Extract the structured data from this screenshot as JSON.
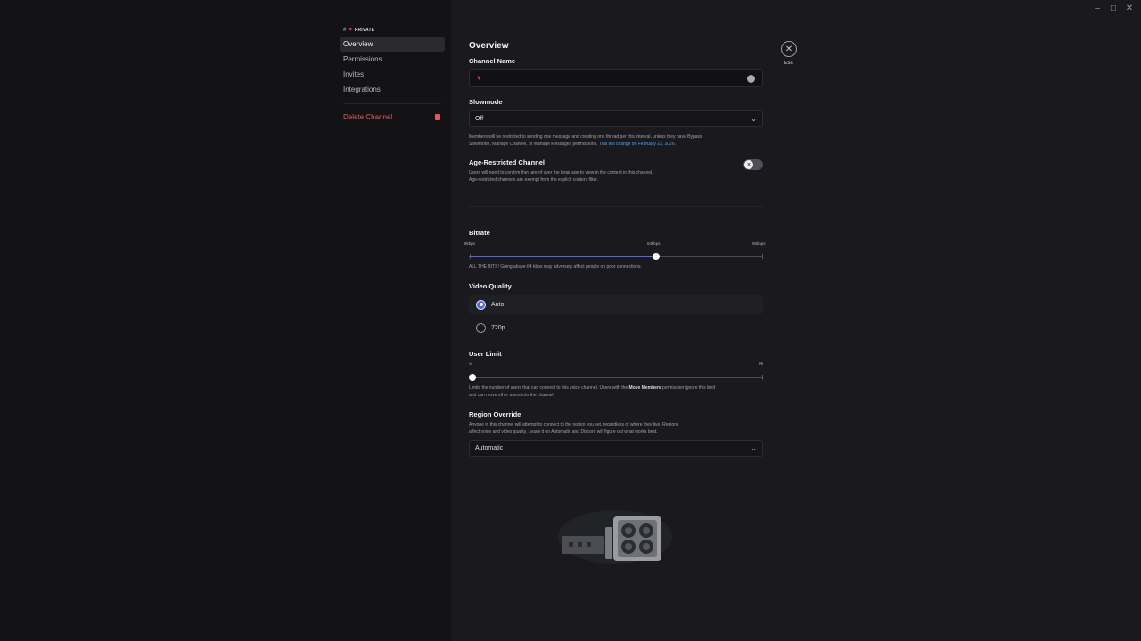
{
  "window": {
    "minimize_glyph": "–",
    "maximize_glyph": "□",
    "close_glyph": "✕"
  },
  "sidebar": {
    "header": {
      "hash": "#",
      "label": "PRIVATE"
    },
    "items": [
      {
        "label": "Overview",
        "active": true
      },
      {
        "label": "Permissions",
        "active": false
      },
      {
        "label": "Invites",
        "active": false
      },
      {
        "label": "Integrations",
        "active": false
      }
    ],
    "delete_label": "Delete Channel"
  },
  "main": {
    "title": "Overview",
    "esc_label": "ESC",
    "channel_name": {
      "label": "Channel Name",
      "value": "♥"
    },
    "slowmode": {
      "label": "Slowmode",
      "value": "Off",
      "help_line1": "Members will be restricted to sending one message and creating one thread per this interval, unless they have Bypass",
      "help_line2": "Slowmode, Manage Channel, or Manage Messages permissions.",
      "help_link": "This will change on February 23, 2026."
    },
    "age_restricted": {
      "label": "Age-Restricted Channel",
      "desc_line1": "Users will need to confirm they are of over the legal age to view in the content in this channel.",
      "desc_line2": "Age-restricted channels are exempt from the explicit content filter.",
      "enabled": false
    },
    "bitrate": {
      "label": "Bitrate",
      "min_label": "8kbps",
      "mid_label": "64kbps",
      "max_label": "96kbps",
      "value_kbps": 64,
      "min_kbps": 8,
      "max_kbps": 96,
      "note": "ALL THE BITS! Going above 64 kbps may adversely affect people on poor connections."
    },
    "video_quality": {
      "label": "Video Quality",
      "options": [
        {
          "label": "Auto",
          "selected": true
        },
        {
          "label": "720p",
          "selected": false
        }
      ]
    },
    "user_limit": {
      "label": "User Limit",
      "min_label": "∞",
      "max_label": "99",
      "value": 0,
      "note_line1_a": "Limits the number of users that can connect to this voice channel. Users with the ",
      "note_line1_bold": "Move Members",
      "note_line1_b": " permission ignore this limit",
      "note_line2": "and can move other users into the channel."
    },
    "region_override": {
      "label": "Region Override",
      "desc_line1": "Anyone in this channel will attempt to connect to the region you set, regardless of where they live. Regions",
      "desc_line2": "affect voice and video quality. Leave it on Automatic and Discord will figure out what works best.",
      "value": "Automatic"
    }
  },
  "colors": {
    "accent": "#5865f2",
    "danger": "#e05a5d",
    "link": "#4aa8f5",
    "sidebar_bg": "#131316",
    "content_bg": "#1a1a1e"
  }
}
